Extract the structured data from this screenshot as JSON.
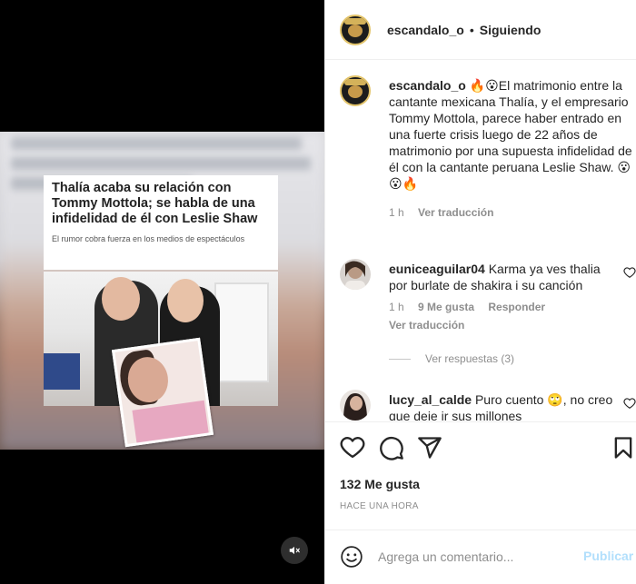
{
  "post": {
    "username": "escandalo_o",
    "dot": "•",
    "following_label": "Siguiendo",
    "media": {
      "headline": "Thalía acaba su relación con Tommy Mottola; se habla de una infidelidad de él con Leslie Shaw",
      "subheadline": "El rumor cobra fuerza en los medios de espectáculos",
      "mute_icon": "speaker-muted-icon"
    },
    "caption": {
      "username": "escandalo_o",
      "text": "🔥😮El matrimonio entre la cantante mexicana Thalía, y el empresario Tommy Mottola, parece haber entrado en una fuerte crisis luego de 22 años de matrimonio por una supuesta infidelidad de él con la cantante peruana Leslie Shaw. 😮😮🔥",
      "time": "1 h",
      "translate": "Ver traducción"
    },
    "comments": [
      {
        "username": "euniceaguilar04",
        "text": "Karma ya ves thalia por burlate de shakira i su canción",
        "time": "1 h",
        "likes": "9 Me gusta",
        "reply": "Responder",
        "translate": "Ver traducción"
      },
      {
        "username": "lucy_al_calde",
        "text": "Puro cuento 🙄, no creo que deje ir sus millones"
      }
    ],
    "view_replies": "Ver respuestas (3)",
    "likes_count": "132 Me gusta",
    "timestamp": "HACE UNA HORA",
    "comment_placeholder": "Agrega un comentario...",
    "publish_label": "Publicar"
  }
}
